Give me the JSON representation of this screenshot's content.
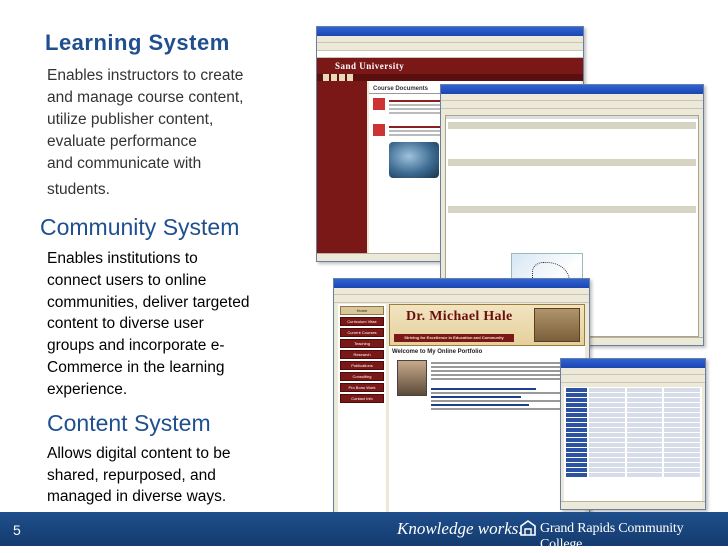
{
  "learning": {
    "title": "Learning System",
    "lines": [
      "Enables instructors to create",
      "and manage course content,",
      "utilize publisher content,",
      "evaluate performance",
      "and communicate with",
      "students."
    ]
  },
  "community": {
    "title": "Community System",
    "lines": [
      "Enables institutions to",
      "connect users to online",
      "communities, deliver targeted",
      "content to diverse user",
      "groups and incorporate e-",
      "Commerce in the learning",
      "experience."
    ]
  },
  "content": {
    "title": "Content System",
    "lines": [
      "Allows digital content to be",
      "shared,  repurposed, and",
      "managed in diverse ways."
    ]
  },
  "screenshots": {
    "sand": {
      "banner": "Sand University",
      "heading": "Course Documents"
    },
    "hale": {
      "name": "Dr. Michael Hale",
      "tagline": "Striving for Excellence in Education and Community",
      "welcome": "Welcome to My Online Portfolio",
      "nav": [
        "Home",
        "Curriculum Vitae",
        "Current Courses",
        "Teaching",
        "Research",
        "Publications",
        "Consulting",
        "Pro Bono Work",
        "Contact Info"
      ]
    }
  },
  "footer": {
    "page": "5",
    "tagline": "Knowledge works.",
    "college": "Grand Rapids Community College"
  },
  "colors": {
    "heading": "#1f4f8f",
    "footer": "#1f4f8c",
    "university_red": "#7a1717"
  }
}
